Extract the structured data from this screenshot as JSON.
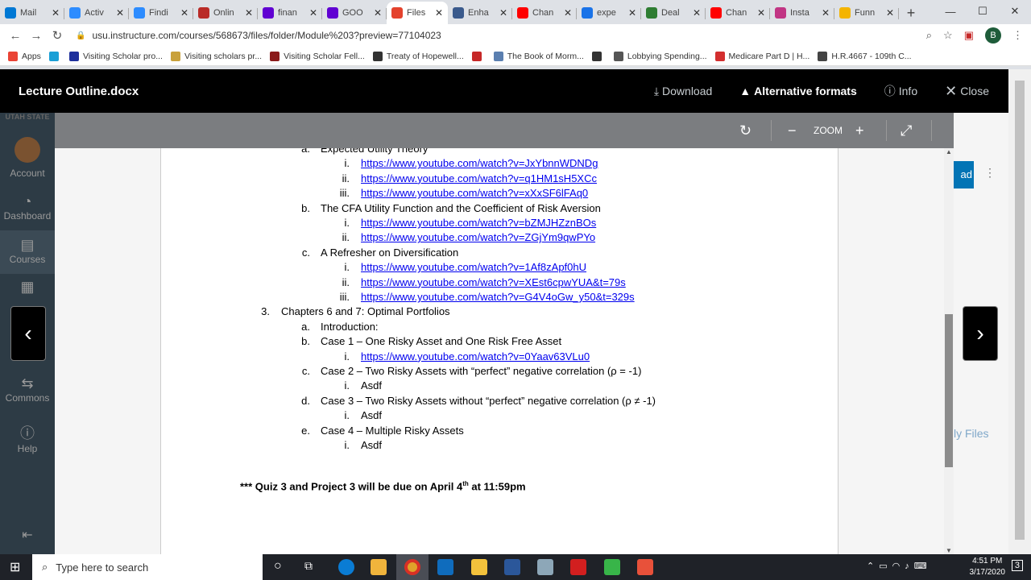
{
  "browser": {
    "tabs": [
      {
        "title": "Mail",
        "color": "#0078d4",
        "active": false
      },
      {
        "title": "Activ",
        "color": "#2d8cff",
        "active": false
      },
      {
        "title": "Findi",
        "color": "#2d8cff",
        "active": false
      },
      {
        "title": "Onlin",
        "color": "#b92b27",
        "active": false
      },
      {
        "title": "finan",
        "color": "#6001d2",
        "active": false
      },
      {
        "title": "GOO",
        "color": "#6001d2",
        "active": false
      },
      {
        "title": "Files",
        "color": "#e4422d",
        "active": true
      },
      {
        "title": "Enha",
        "color": "#3a5a8c",
        "active": false
      },
      {
        "title": "Chan",
        "color": "#ff0000",
        "active": false
      },
      {
        "title": "expe",
        "color": "#1a73e8",
        "active": false
      },
      {
        "title": "Deal",
        "color": "#2e7d32",
        "active": false
      },
      {
        "title": "Chan",
        "color": "#ff0000",
        "active": false
      },
      {
        "title": "Insta",
        "color": "#c13584",
        "active": false
      },
      {
        "title": "Funn",
        "color": "#f4b400",
        "active": false
      }
    ],
    "new_tab": "+",
    "url": "usu.instructure.com/courses/568673/files/folder/Module%203?preview=77104023",
    "profile_initial": "B",
    "bookmarks": [
      {
        "label": "Apps",
        "color": "#ea4335"
      },
      {
        "label": "",
        "color": "#1a9fd6"
      },
      {
        "label": "Visiting Scholar pro...",
        "color": "#1d2f9c"
      },
      {
        "label": "Visiting scholars pr...",
        "color": "#c9a13b"
      },
      {
        "label": "Visiting Scholar Fell...",
        "color": "#8b1a1a"
      },
      {
        "label": "Treaty of Hopewell...",
        "color": "#333"
      },
      {
        "label": "",
        "color": "#c62828"
      },
      {
        "label": "The Book of Morm...",
        "color": "#5b7fb0"
      },
      {
        "label": "",
        "color": "#333"
      },
      {
        "label": "Lobbying Spending...",
        "color": "#555"
      },
      {
        "label": "Medicare Part D | H...",
        "color": "#d32f2f"
      },
      {
        "label": "H.R.4667 - 109th C...",
        "color": "#444"
      }
    ]
  },
  "viewer": {
    "file_name": "Lecture Outline.docx",
    "actions": {
      "download": "Download",
      "alt_formats": "Alternative formats",
      "info": "Info",
      "close": "Close"
    },
    "zoom_label": "ZOOM"
  },
  "canvas_nav": {
    "logo": "UTAH STATE",
    "items": [
      "Account",
      "Dashboard",
      "Courses",
      "",
      "Commons",
      "Help"
    ]
  },
  "right_fragments": {
    "button": "ad",
    "files_link": "ly Files"
  },
  "document": {
    "lines": [
      {
        "marker": "a.",
        "text": "Expected Utility Theory",
        "level": 2,
        "link": false
      },
      {
        "marker": "i.",
        "text": "https://www.youtube.com/watch?v=JxYbnnWDNDg",
        "level": 3,
        "link": true
      },
      {
        "marker": "ii.",
        "text": "https://www.youtube.com/watch?v=q1HM1sH5XCc",
        "level": 3,
        "link": true
      },
      {
        "marker": "iii.",
        "text": "https://www.youtube.com/watch?v=xXxSF6lFAq0",
        "level": 3,
        "link": true
      },
      {
        "marker": "b.",
        "text": "The CFA Utility Function and the Coefficient of Risk Aversion",
        "level": 2,
        "link": false
      },
      {
        "marker": "i.",
        "text": "https://www.youtube.com/watch?v=bZMJHZznBOs",
        "level": 3,
        "link": true
      },
      {
        "marker": "ii.",
        "text": "https://www.youtube.com/watch?v=ZGjYm9qwPYo",
        "level": 3,
        "link": true
      },
      {
        "marker": "c.",
        "text": "A Refresher on Diversification",
        "level": 2,
        "link": false
      },
      {
        "marker": "i.",
        "text": "https://www.youtube.com/watch?v=1Af8zApf0hU",
        "level": 3,
        "link": true
      },
      {
        "marker": "ii.",
        "text": "https://www.youtube.com/watch?v=XEst6cpwYUA&t=79s",
        "level": 3,
        "link": true
      },
      {
        "marker": "iii.",
        "text": "https://www.youtube.com/watch?v=G4V4oGw_y50&t=329s",
        "level": 3,
        "link": true
      },
      {
        "marker": "3.",
        "text": "Chapters 6 and 7: Optimal Portfolios",
        "level": 1,
        "link": false
      },
      {
        "marker": "a.",
        "text": "Introduction:",
        "level": 2,
        "link": false
      },
      {
        "marker": "b.",
        "text": "Case 1 – One Risky Asset and One Risk Free Asset",
        "level": 2,
        "link": false
      },
      {
        "marker": "i.",
        "text": "https://www.youtube.com/watch?v=0Yaav63VLu0",
        "level": 3,
        "link": true
      },
      {
        "marker": "c.",
        "text": "Case 2 – Two Risky Assets with “perfect” negative correlation (ρ = -1)",
        "level": 2,
        "link": false
      },
      {
        "marker": "i.",
        "text": "Asdf",
        "level": 3,
        "link": false
      },
      {
        "marker": "d.",
        "text": "Case 3 – Two Risky Assets without “perfect” negative correlation (ρ ≠ -1)",
        "level": 2,
        "link": false
      },
      {
        "marker": "i.",
        "text": "Asdf",
        "level": 3,
        "link": false
      },
      {
        "marker": "e.",
        "text": "Case 4 – Multiple Risky Assets",
        "level": 2,
        "link": false
      },
      {
        "marker": "i.",
        "text": "Asdf",
        "level": 3,
        "link": false
      }
    ],
    "note_prefix": "*** Quiz 3 and Project 3 will be due on April 4",
    "note_sup": "th",
    "note_suffix": " at 11:59pm"
  },
  "taskbar": {
    "search_placeholder": "Type here to search",
    "time": "4:51 PM",
    "date": "3/17/2020",
    "notification_count": "3"
  }
}
